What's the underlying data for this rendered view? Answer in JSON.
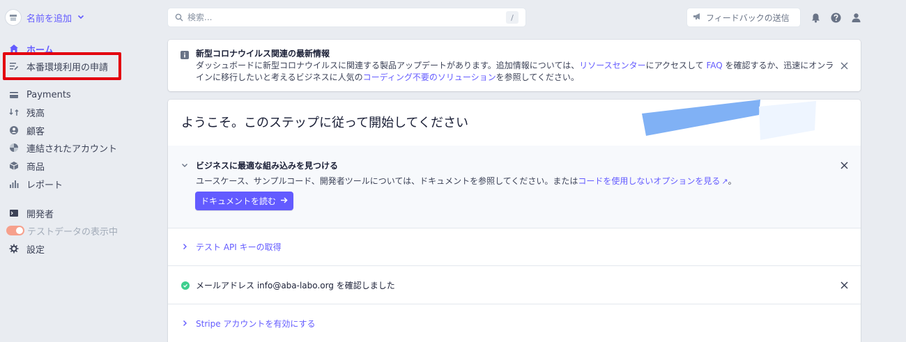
{
  "sidebar": {
    "account_name": "名前を追加",
    "items": [
      {
        "label": "ホーム",
        "icon": "home-icon"
      },
      {
        "label": "本番環境利用の申請",
        "icon": "checklist-icon"
      },
      {
        "label": "Payments",
        "icon": "payments-icon"
      },
      {
        "label": "残高",
        "icon": "balance-icon"
      },
      {
        "label": "顧客",
        "icon": "customer-icon"
      },
      {
        "label": "連結されたアカウント",
        "icon": "connect-icon"
      },
      {
        "label": "商品",
        "icon": "product-icon"
      },
      {
        "label": "レポート",
        "icon": "report-icon"
      },
      {
        "label": "開発者",
        "icon": "terminal-icon"
      },
      {
        "label": "テストデータの表示中",
        "icon": "toggle-icon"
      },
      {
        "label": "設定",
        "icon": "gear-icon"
      }
    ]
  },
  "topbar": {
    "search_placeholder": "検索...",
    "search_shortcut": "/",
    "feedback_label": "フィードバックの送信"
  },
  "notice": {
    "title": "新型コロナウイルス関連の最新情報",
    "text_1": "ダッシュボードに新型コロナウイルスに関連する製品アップデートがあります。追加情報については、",
    "link_1": "リソースセンター",
    "text_2": "にアクセスして ",
    "link_2": "FAQ",
    "text_3": " を確認するか、迅速にオンラインに移行したいと考えるビジネスに人気の",
    "link_3": "コーディング不要のソリューション",
    "text_4": "を参照してください。"
  },
  "main": {
    "title": "ようこそ。このステップに従って開始してください",
    "steps": {
      "integration": {
        "title": "ビジネスに最適な組み込みを見つける",
        "desc_text": "ユースケース、サンプルコード、開発者ツールについては、ドキュメントを参照してください。または",
        "desc_link": "コードを使用しないオプションを見る",
        "desc_end": "。",
        "button_label": "ドキュメントを読む"
      },
      "api_key": {
        "title": "テスト API キーの取得"
      },
      "email": {
        "title": "メールアドレス info@aba-labo.org を確認しました"
      },
      "activate": {
        "title": "Stripe アカウントを有効にする"
      }
    }
  },
  "colors": {
    "accent": "#635bff",
    "highlight_border": "#e3000f",
    "success": "#3ecf8e",
    "background": "#e9ecf1"
  }
}
